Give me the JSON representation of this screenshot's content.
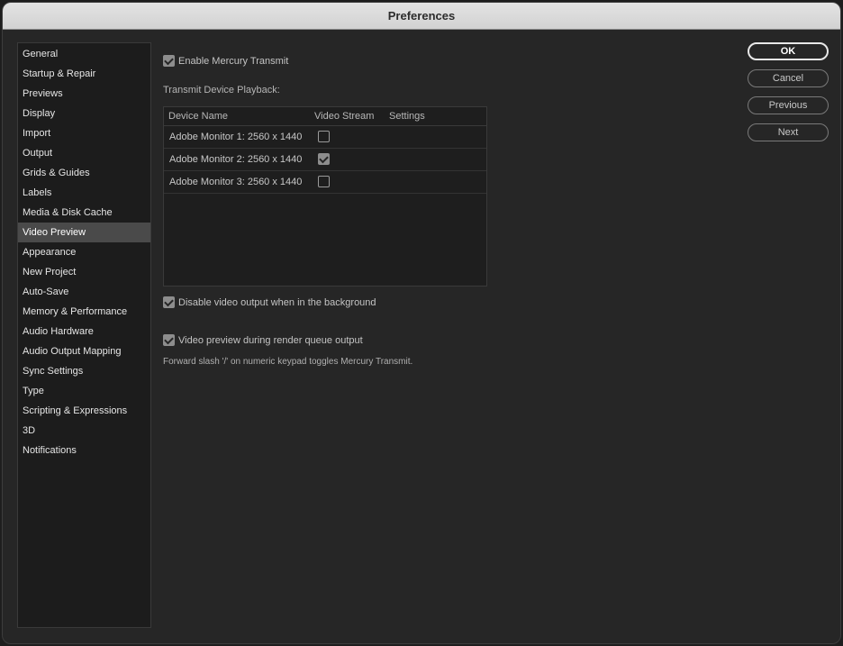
{
  "window": {
    "title": "Preferences"
  },
  "sidebar": {
    "items": [
      {
        "label": "General",
        "selected": false
      },
      {
        "label": "Startup & Repair",
        "selected": false
      },
      {
        "label": "Previews",
        "selected": false
      },
      {
        "label": "Display",
        "selected": false
      },
      {
        "label": "Import",
        "selected": false
      },
      {
        "label": "Output",
        "selected": false
      },
      {
        "label": "Grids & Guides",
        "selected": false
      },
      {
        "label": "Labels",
        "selected": false
      },
      {
        "label": "Media & Disk Cache",
        "selected": false
      },
      {
        "label": "Video Preview",
        "selected": true
      },
      {
        "label": "Appearance",
        "selected": false
      },
      {
        "label": "New Project",
        "selected": false
      },
      {
        "label": "Auto-Save",
        "selected": false
      },
      {
        "label": "Memory & Performance",
        "selected": false
      },
      {
        "label": "Audio Hardware",
        "selected": false
      },
      {
        "label": "Audio Output Mapping",
        "selected": false
      },
      {
        "label": "Sync Settings",
        "selected": false
      },
      {
        "label": "Type",
        "selected": false
      },
      {
        "label": "Scripting & Expressions",
        "selected": false
      },
      {
        "label": "3D",
        "selected": false
      },
      {
        "label": "Notifications",
        "selected": false
      }
    ]
  },
  "main": {
    "enable_mercury": {
      "label": "Enable Mercury Transmit",
      "checked": true
    },
    "transmit_label": "Transmit Device Playback:",
    "table": {
      "headers": {
        "device_name": "Device Name",
        "video_stream": "Video Stream",
        "settings": "Settings"
      },
      "rows": [
        {
          "name": "Adobe Monitor 1: 2560 x 1440",
          "stream": false
        },
        {
          "name": "Adobe Monitor 2: 2560 x 1440",
          "stream": true
        },
        {
          "name": "Adobe Monitor 3: 2560 x 1440",
          "stream": false
        }
      ]
    },
    "disable_background": {
      "label": "Disable video output when in the background",
      "checked": true
    },
    "render_queue": {
      "label": "Video preview during render queue output",
      "checked": true
    },
    "hint": "Forward slash '/' on numeric keypad toggles Mercury Transmit."
  },
  "buttons": {
    "ok": "OK",
    "cancel": "Cancel",
    "previous": "Previous",
    "next": "Next"
  },
  "colors": {
    "background": "#262626",
    "selected": "#4a4a4a",
    "titlebar": "#d8d8d8"
  }
}
